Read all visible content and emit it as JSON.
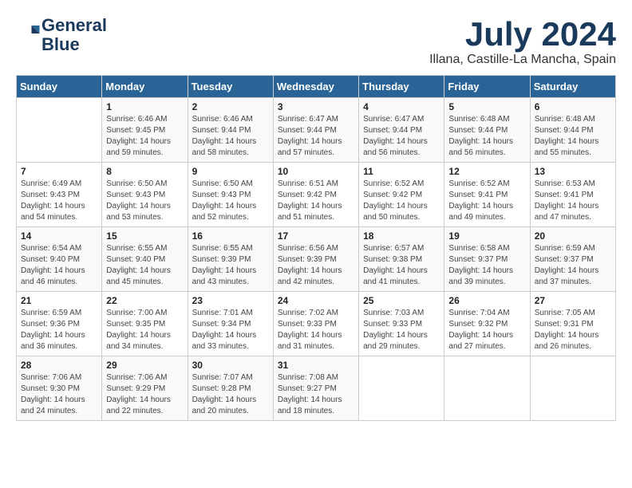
{
  "logo": {
    "line1": "General",
    "line2": "Blue"
  },
  "title": "July 2024",
  "subtitle": "Illana, Castille-La Mancha, Spain",
  "headers": [
    "Sunday",
    "Monday",
    "Tuesday",
    "Wednesday",
    "Thursday",
    "Friday",
    "Saturday"
  ],
  "weeks": [
    [
      {
        "day": "",
        "text": ""
      },
      {
        "day": "1",
        "text": "Sunrise: 6:46 AM\nSunset: 9:45 PM\nDaylight: 14 hours\nand 59 minutes."
      },
      {
        "day": "2",
        "text": "Sunrise: 6:46 AM\nSunset: 9:44 PM\nDaylight: 14 hours\nand 58 minutes."
      },
      {
        "day": "3",
        "text": "Sunrise: 6:47 AM\nSunset: 9:44 PM\nDaylight: 14 hours\nand 57 minutes."
      },
      {
        "day": "4",
        "text": "Sunrise: 6:47 AM\nSunset: 9:44 PM\nDaylight: 14 hours\nand 56 minutes."
      },
      {
        "day": "5",
        "text": "Sunrise: 6:48 AM\nSunset: 9:44 PM\nDaylight: 14 hours\nand 56 minutes."
      },
      {
        "day": "6",
        "text": "Sunrise: 6:48 AM\nSunset: 9:44 PM\nDaylight: 14 hours\nand 55 minutes."
      }
    ],
    [
      {
        "day": "7",
        "text": "Sunrise: 6:49 AM\nSunset: 9:43 PM\nDaylight: 14 hours\nand 54 minutes."
      },
      {
        "day": "8",
        "text": "Sunrise: 6:50 AM\nSunset: 9:43 PM\nDaylight: 14 hours\nand 53 minutes."
      },
      {
        "day": "9",
        "text": "Sunrise: 6:50 AM\nSunset: 9:43 PM\nDaylight: 14 hours\nand 52 minutes."
      },
      {
        "day": "10",
        "text": "Sunrise: 6:51 AM\nSunset: 9:42 PM\nDaylight: 14 hours\nand 51 minutes."
      },
      {
        "day": "11",
        "text": "Sunrise: 6:52 AM\nSunset: 9:42 PM\nDaylight: 14 hours\nand 50 minutes."
      },
      {
        "day": "12",
        "text": "Sunrise: 6:52 AM\nSunset: 9:41 PM\nDaylight: 14 hours\nand 49 minutes."
      },
      {
        "day": "13",
        "text": "Sunrise: 6:53 AM\nSunset: 9:41 PM\nDaylight: 14 hours\nand 47 minutes."
      }
    ],
    [
      {
        "day": "14",
        "text": "Sunrise: 6:54 AM\nSunset: 9:40 PM\nDaylight: 14 hours\nand 46 minutes."
      },
      {
        "day": "15",
        "text": "Sunrise: 6:55 AM\nSunset: 9:40 PM\nDaylight: 14 hours\nand 45 minutes."
      },
      {
        "day": "16",
        "text": "Sunrise: 6:55 AM\nSunset: 9:39 PM\nDaylight: 14 hours\nand 43 minutes."
      },
      {
        "day": "17",
        "text": "Sunrise: 6:56 AM\nSunset: 9:39 PM\nDaylight: 14 hours\nand 42 minutes."
      },
      {
        "day": "18",
        "text": "Sunrise: 6:57 AM\nSunset: 9:38 PM\nDaylight: 14 hours\nand 41 minutes."
      },
      {
        "day": "19",
        "text": "Sunrise: 6:58 AM\nSunset: 9:37 PM\nDaylight: 14 hours\nand 39 minutes."
      },
      {
        "day": "20",
        "text": "Sunrise: 6:59 AM\nSunset: 9:37 PM\nDaylight: 14 hours\nand 37 minutes."
      }
    ],
    [
      {
        "day": "21",
        "text": "Sunrise: 6:59 AM\nSunset: 9:36 PM\nDaylight: 14 hours\nand 36 minutes."
      },
      {
        "day": "22",
        "text": "Sunrise: 7:00 AM\nSunset: 9:35 PM\nDaylight: 14 hours\nand 34 minutes."
      },
      {
        "day": "23",
        "text": "Sunrise: 7:01 AM\nSunset: 9:34 PM\nDaylight: 14 hours\nand 33 minutes."
      },
      {
        "day": "24",
        "text": "Sunrise: 7:02 AM\nSunset: 9:33 PM\nDaylight: 14 hours\nand 31 minutes."
      },
      {
        "day": "25",
        "text": "Sunrise: 7:03 AM\nSunset: 9:33 PM\nDaylight: 14 hours\nand 29 minutes."
      },
      {
        "day": "26",
        "text": "Sunrise: 7:04 AM\nSunset: 9:32 PM\nDaylight: 14 hours\nand 27 minutes."
      },
      {
        "day": "27",
        "text": "Sunrise: 7:05 AM\nSunset: 9:31 PM\nDaylight: 14 hours\nand 26 minutes."
      }
    ],
    [
      {
        "day": "28",
        "text": "Sunrise: 7:06 AM\nSunset: 9:30 PM\nDaylight: 14 hours\nand 24 minutes."
      },
      {
        "day": "29",
        "text": "Sunrise: 7:06 AM\nSunset: 9:29 PM\nDaylight: 14 hours\nand 22 minutes."
      },
      {
        "day": "30",
        "text": "Sunrise: 7:07 AM\nSunset: 9:28 PM\nDaylight: 14 hours\nand 20 minutes."
      },
      {
        "day": "31",
        "text": "Sunrise: 7:08 AM\nSunset: 9:27 PM\nDaylight: 14 hours\nand 18 minutes."
      },
      {
        "day": "",
        "text": ""
      },
      {
        "day": "",
        "text": ""
      },
      {
        "day": "",
        "text": ""
      }
    ]
  ]
}
